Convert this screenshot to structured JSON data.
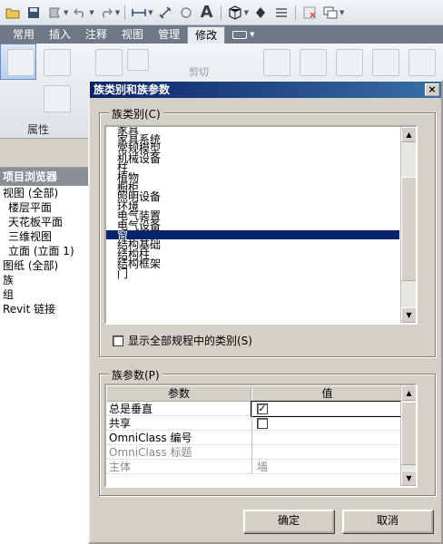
{
  "toolbar": {
    "icons": [
      "open-folder-icon",
      "save-icon",
      "sync-icon",
      "undo-icon",
      "redo-icon",
      "measure-icon",
      "dimension-icon",
      "tag-icon",
      "text-icon",
      "3d-view-icon",
      "section-icon",
      "thin-lines-icon",
      "close-window-icon",
      "switch-window-icon"
    ],
    "text_icon_glyph": "A"
  },
  "ribbon": {
    "tabs": [
      "常用",
      "插入",
      "注释",
      "视图",
      "管理",
      "修改"
    ],
    "active_tab": "修改",
    "properties_label": "属性",
    "cut_label": "剪切"
  },
  "project_browser": {
    "title": "项目浏览器",
    "items": [
      {
        "label": "视图 (全部)",
        "level": 0
      },
      {
        "label": "楼层平面",
        "level": 1
      },
      {
        "label": "天花板平面",
        "level": 1
      },
      {
        "label": "三维视图",
        "level": 1
      },
      {
        "label": "立面 (立面 1)",
        "level": 1
      },
      {
        "label": "图纸 (全部)",
        "level": 0
      },
      {
        "label": "族",
        "level": 0
      },
      {
        "label": "组",
        "level": 0
      },
      {
        "label": "Revit 链接",
        "level": 0
      }
    ]
  },
  "dialog": {
    "title": "族类别和族参数",
    "close_glyph": "×",
    "category_group_label": "族类别(C)",
    "categories": [
      "家具",
      "家具系统",
      "常规模型",
      "机械设备",
      "柱",
      "植物",
      "橱柜",
      "照明设备",
      "环境",
      "电气装置",
      "电气设备",
      "窗",
      "结构基础",
      "结构柱",
      "结构框架",
      "门"
    ],
    "selected_category": "窗",
    "show_all_label": "显示全部规程中的类别(S)",
    "show_all_checked": false,
    "param_group_label": "族参数(P)",
    "param_headers": [
      "参数",
      "值"
    ],
    "params": [
      {
        "name": "总是垂直",
        "value": "",
        "checkbox": true,
        "checked": true,
        "disabled": false
      },
      {
        "name": "共享",
        "value": "",
        "checkbox": true,
        "checked": false,
        "disabled": false
      },
      {
        "name": "OmniClass 编号",
        "value": "",
        "checkbox": false,
        "disabled": false
      },
      {
        "name": "OmniClass 标题",
        "value": "",
        "checkbox": false,
        "disabled": true
      },
      {
        "name": "主体",
        "value": "墙",
        "checkbox": false,
        "disabled": true
      }
    ],
    "ok_label": "确定",
    "cancel_label": "取消",
    "check_glyph": "✓"
  }
}
